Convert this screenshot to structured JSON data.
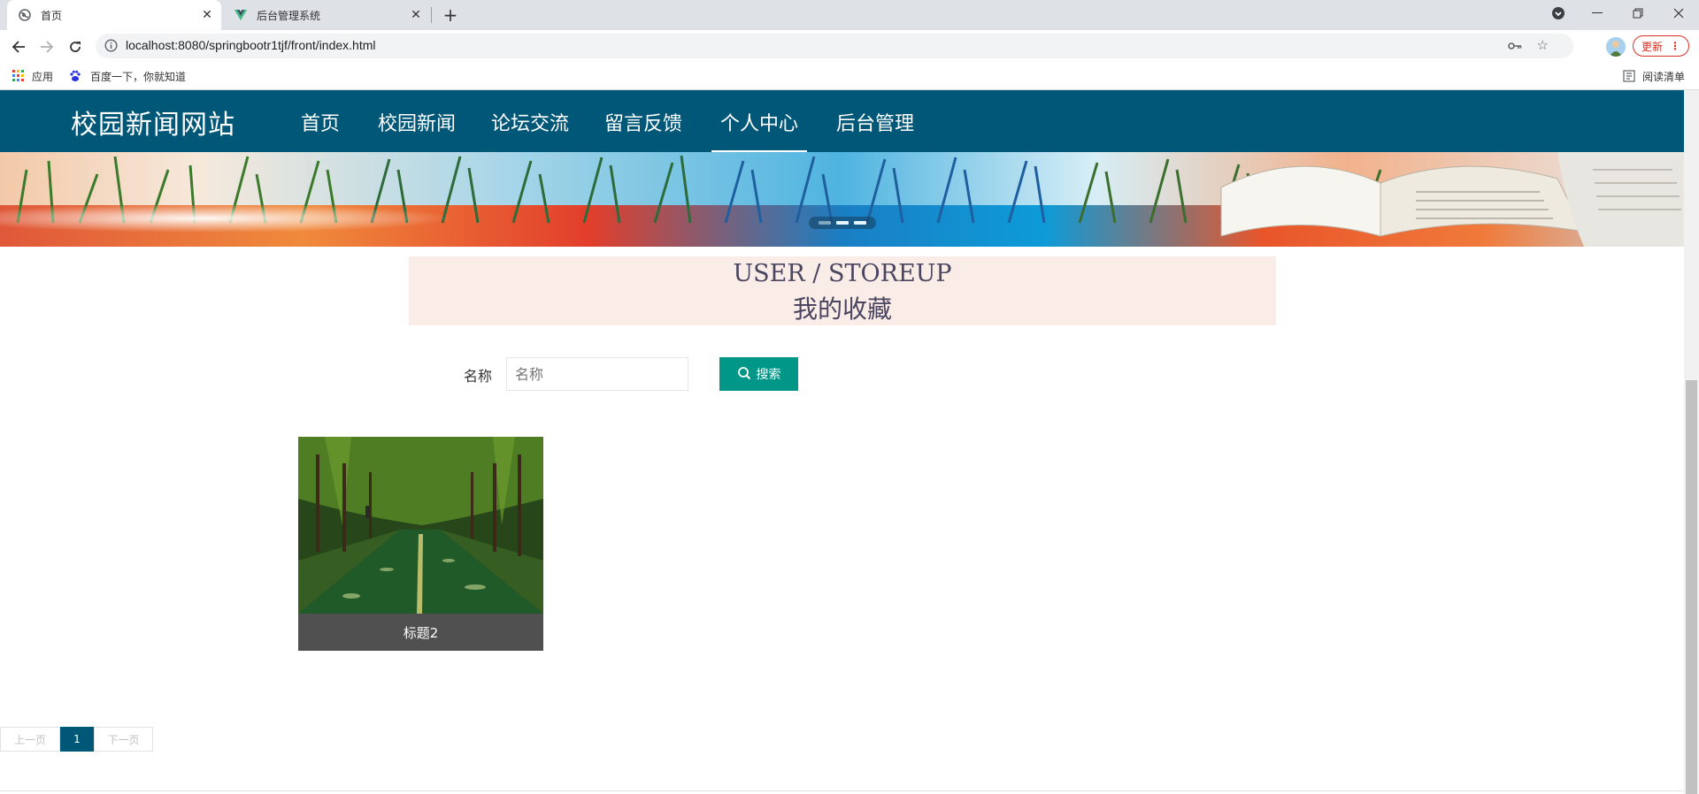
{
  "browser": {
    "tabs": [
      {
        "title": "首页",
        "active": true
      },
      {
        "title": "后台管理系统",
        "active": false
      }
    ],
    "url": "localhost:8080/springbootr1tjf/front/index.html",
    "update_label": "更新",
    "bookmarks": [
      {
        "label": "应用",
        "icon": "apps-grid-icon"
      },
      {
        "label": "百度一下，你就知道",
        "icon": "baidu-paw-icon"
      }
    ],
    "reading_list_label": "阅读清单"
  },
  "site": {
    "brand": "校园新闻网站",
    "nav": [
      {
        "label": "首页",
        "active": false
      },
      {
        "label": "校园新闻",
        "active": false
      },
      {
        "label": "论坛交流",
        "active": false
      },
      {
        "label": "留言反馈",
        "active": false
      },
      {
        "label": "个人中心",
        "active": true
      },
      {
        "label": "后台管理",
        "active": false
      }
    ],
    "nav_color": "#015777"
  },
  "section": {
    "title_en": "USER / STOREUP",
    "title_cn": "我的收藏"
  },
  "search": {
    "label": "名称",
    "placeholder": "名称",
    "button_label": "搜索",
    "button_color": "#009688"
  },
  "items": [
    {
      "title": "标题2",
      "image": "tree-lined-road-photo"
    }
  ],
  "pagination": {
    "prev_label": "上一页",
    "current": "1",
    "next_label": "下一页"
  }
}
